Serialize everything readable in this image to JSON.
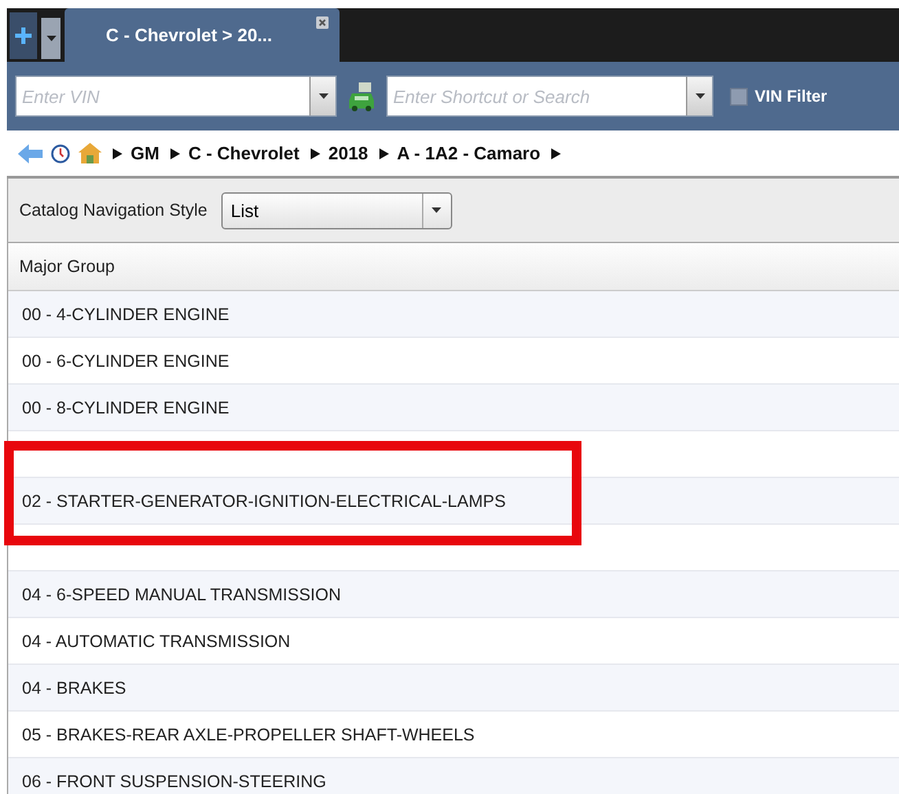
{
  "tab_bar": {
    "tabs": [
      {
        "label": "C - Chevrolet > 20...",
        "selected": true
      }
    ]
  },
  "toolbar": {
    "vin_field": {
      "placeholder": "Enter VIN"
    },
    "search_field": {
      "placeholder": "Enter Shortcut or Search"
    },
    "vin_filter": {
      "label": "VIN Filter",
      "checked": false
    }
  },
  "breadcrumb": [
    "GM",
    "C - Chevrolet",
    "2018",
    "A - 1A2 - Camaro"
  ],
  "navigation_style": {
    "label": "Catalog Navigation Style",
    "value": "List"
  },
  "list": {
    "header": "Major Group",
    "rows": [
      {
        "kind": "text",
        "label": "00 - 4-CYLINDER ENGINE"
      },
      {
        "kind": "text",
        "label": "00 - 6-CYLINDER ENGINE"
      },
      {
        "kind": "text",
        "label": "00 - 8-CYLINDER ENGINE"
      },
      {
        "kind": "covered"
      },
      {
        "kind": "text",
        "label": "02 - STARTER-GENERATOR-IGNITION-ELECTRICAL-LAMPS"
      },
      {
        "kind": "covered"
      },
      {
        "kind": "text",
        "label": "04 - 6-SPEED MANUAL TRANSMISSION"
      },
      {
        "kind": "text",
        "label": "04 - AUTOMATIC TRANSMISSION"
      },
      {
        "kind": "text",
        "label": "04 - BRAKES"
      },
      {
        "kind": "text",
        "label": "05 - BRAKES-REAR AXLE-PROPELLER SHAFT-WHEELS"
      },
      {
        "kind": "text",
        "label": "06 - FRONT SUSPENSION-STEERING"
      }
    ]
  }
}
